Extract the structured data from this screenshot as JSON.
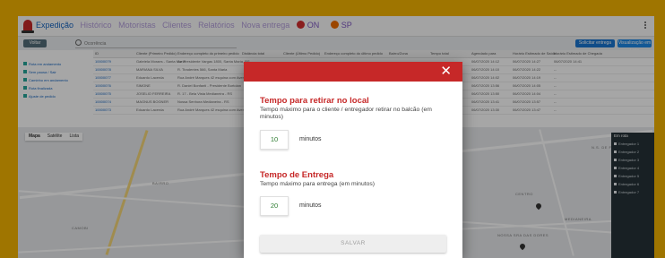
{
  "app": {
    "title": "Expedição",
    "nav": [
      "Histórico",
      "Motoristas",
      "Clientes",
      "Relatórios",
      "Nova entrega"
    ],
    "extra_nav": [
      "ON",
      "SP"
    ],
    "accent": "#c62828",
    "frame_color": "#f5b400"
  },
  "toolbar": {
    "back_label": "Voltar",
    "search_placeholder": "Ocorrência",
    "btn_primary": "Solicitar entrega",
    "btn_secondary": "Visualização em Lista"
  },
  "table": {
    "headers": [
      "ID",
      "Cliente (Primeiro Pedido)",
      "Endereço completo do primeiro pedido",
      "Distância total",
      "Cliente (Último Pedido)",
      "Endereço completo do último pedido",
      "Bairro/Zona",
      "Tempo total",
      "Agendado para",
      "Horário Estimado de Saída",
      "Horário Estimado de Chegada"
    ],
    "rows": [
      [
        "10000079",
        "Gabriela Moraes - Santa Maria",
        "Av. Presidente Vargas 1800, Santa Maria, RS",
        "",
        "",
        "",
        "",
        "",
        "06/07/2020 14:12",
        "06/07/2020 14:27",
        "06/07/2020 14:41"
      ],
      [
        "10000078",
        "MARIANA SILVA",
        "R. Tiradentes 566, Santa Maria",
        "",
        "",
        "",
        "",
        "",
        "06/07/2020 14:10",
        "06/07/2020 14:22",
        "--"
      ],
      [
        "10000077",
        "Eduardo Lacerda",
        "Rua André Marques 42 esquina com Avenida",
        "",
        "",
        "",
        "",
        "",
        "06/07/2020 14:02",
        "06/07/2020 14:19",
        "--"
      ],
      [
        "10000076",
        "SIMONE",
        "R. Daniel Bonfanti - Presidente Bortolan",
        "",
        "",
        "",
        "",
        "",
        "06/07/2020 13:56",
        "06/07/2020 14:05",
        "--"
      ],
      [
        "10000075",
        "JOSELIO FERREIRA",
        "R. 17 - Bela Vista Medianeira - RS",
        "",
        "",
        "",
        "",
        "",
        "06/07/2020 13:50",
        "06/07/2020 14:04",
        "--"
      ],
      [
        "10000074",
        "MAGNUS BOGNER",
        "Nossa Senhora Medianeira - RS",
        "",
        "",
        "",
        "",
        "",
        "06/07/2020 13:41",
        "06/07/2020 13:57",
        "--"
      ],
      [
        "10000073",
        "Eduardo Lacerda",
        "Rua André Marques 42 esquina com Avenida Presidente",
        "",
        "",
        "",
        "",
        "",
        "06/07/2020 13:30",
        "06/07/2020 13:47",
        "--"
      ]
    ],
    "tags": [
      "Rota em andamento",
      "Sem pausa / Sair",
      "Caminho em andamento",
      "Rota finalizada",
      "Ajuste de pedido"
    ]
  },
  "map": {
    "tabs": [
      "Mapa",
      "Satélite",
      "Lista"
    ],
    "labels": [
      "CENTRO",
      "BAIRRO",
      "NOSSA SRA DAS DORES",
      "MEDIANEIRA",
      "CAMOBI",
      "N.S. DE FÁTIMA"
    ],
    "side_panel_title": "Em rota",
    "side_panel_items": [
      "Entregador 1",
      "Entregador 2",
      "Entregador 3",
      "Entregador 4",
      "Entregador 5",
      "Entregador 6",
      "Entregador 7"
    ]
  },
  "modal": {
    "pickup": {
      "title": "Tempo para retirar no local",
      "description": "Tempo máximo para o cliente / entregador retirar no balcão (em minutos)",
      "value": "10",
      "unit": "minutos"
    },
    "delivery": {
      "title": "Tempo de Entrega",
      "description": "Tempo máximo para entrega (em minutos)",
      "value": "20",
      "unit": "minutos"
    },
    "save_label": "SALVAR",
    "close_icon": "close-icon"
  }
}
